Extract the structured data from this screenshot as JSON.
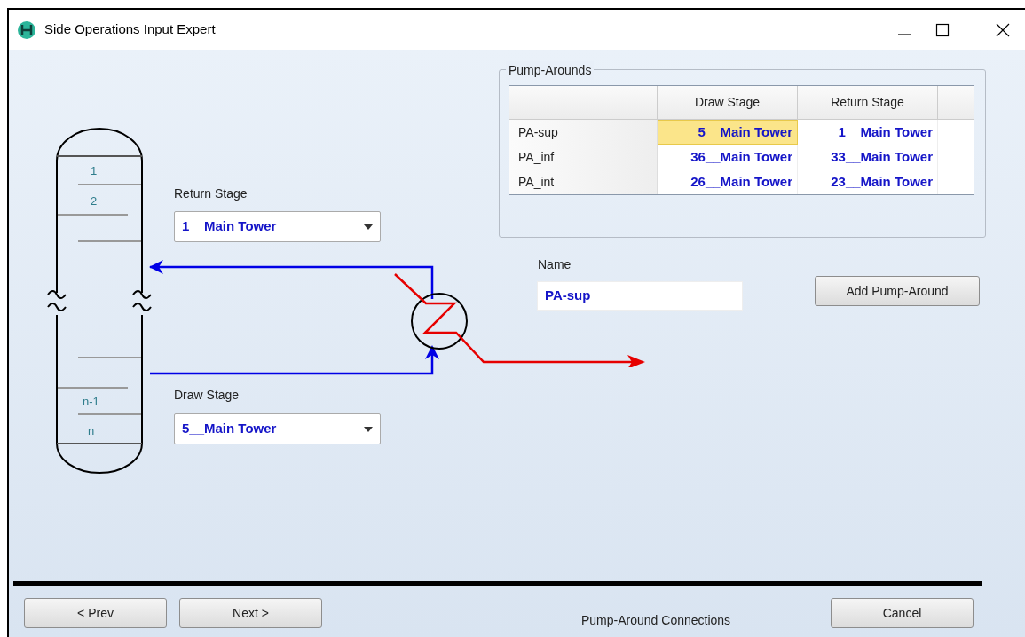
{
  "window": {
    "title": "Side Operations Input Expert"
  },
  "column_diagram": {
    "stage_labels": [
      "1",
      "2",
      "n-1",
      "n"
    ]
  },
  "return_stage": {
    "label": "Return Stage",
    "value": "1__Main Tower"
  },
  "draw_stage": {
    "label": "Draw Stage",
    "value": "5__Main Tower"
  },
  "pump_arounds": {
    "title": "Pump-Arounds",
    "columns": [
      "Draw Stage",
      "Return Stage"
    ],
    "rows": [
      {
        "name": "PA-sup",
        "draw_stage": "5__Main Tower",
        "return_stage": "1__Main Tower",
        "selected": true
      },
      {
        "name": "PA_inf",
        "draw_stage": "36__Main Tower",
        "return_stage": "33__Main Tower",
        "selected": false
      },
      {
        "name": "PA_int",
        "draw_stage": "26__Main Tower",
        "return_stage": "23__Main Tower",
        "selected": false
      }
    ]
  },
  "name_field": {
    "label": "Name",
    "value": "PA-sup"
  },
  "add_button": "Add Pump-Around",
  "footer": {
    "prev": "< Prev",
    "next": "Next >",
    "caption": "Pump-Around Connections",
    "cancel": "Cancel"
  }
}
